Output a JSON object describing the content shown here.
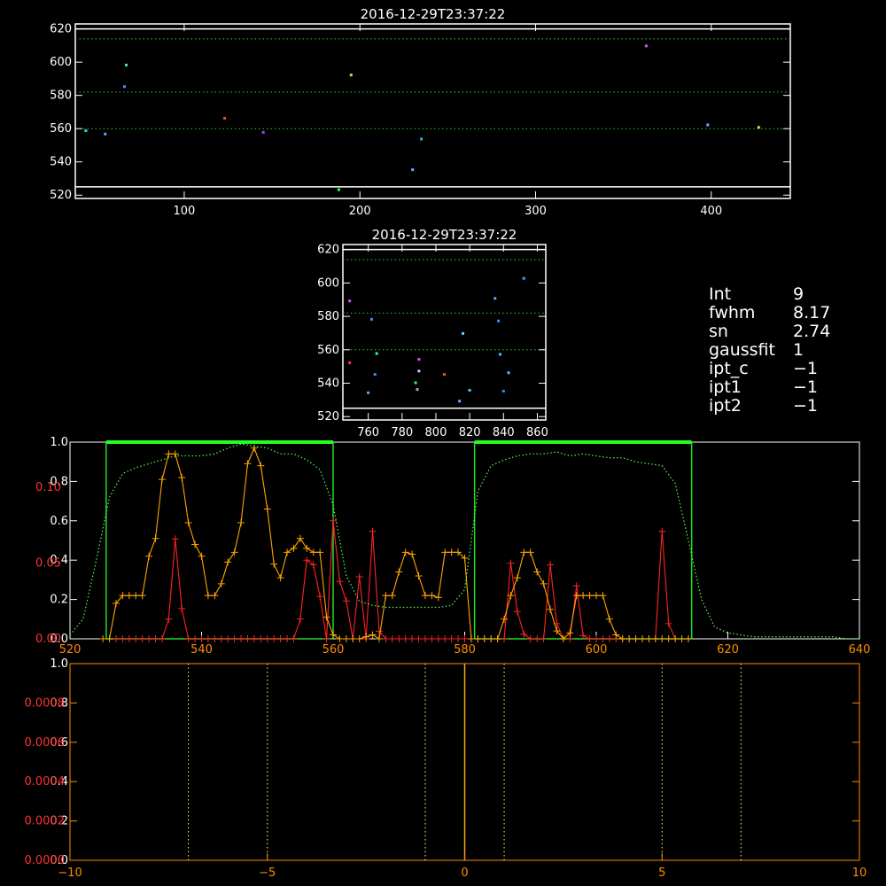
{
  "chart_data": [
    {
      "id": "scatter-top",
      "type": "scatter",
      "title": "2016-12-29T23:37:22",
      "xlim": [
        38,
        445
      ],
      "ylim": [
        518,
        623
      ],
      "xticks": [
        100,
        200,
        300,
        400
      ],
      "yticks": [
        520,
        540,
        560,
        580,
        600,
        620
      ],
      "hlines_dotted": [
        614,
        582,
        560
      ],
      "hlines_solid": [
        620,
        525
      ],
      "points": [
        {
          "x": 44,
          "y": 558.5,
          "color": "#33ccff"
        },
        {
          "x": 55,
          "y": 556.5,
          "color": "#55aaff"
        },
        {
          "x": 66,
          "y": 585,
          "color": "#4f8bff"
        },
        {
          "x": 67,
          "y": 598,
          "color": "#33eecc"
        },
        {
          "x": 123,
          "y": 566,
          "color": "#ff4422"
        },
        {
          "x": 145,
          "y": 557.5,
          "color": "#aa44ff"
        },
        {
          "x": 188,
          "y": 523,
          "color": "#33ff66"
        },
        {
          "x": 195,
          "y": 592,
          "color": "#dddd33"
        },
        {
          "x": 230,
          "y": 535,
          "color": "#77aaff"
        },
        {
          "x": 235,
          "y": 553.5,
          "color": "#33aaff"
        },
        {
          "x": 363,
          "y": 609.5,
          "color": "#cc55ff"
        },
        {
          "x": 398,
          "y": 562,
          "color": "#77aaff"
        },
        {
          "x": 427,
          "y": 560.5,
          "color": "#dddd33"
        }
      ]
    },
    {
      "id": "scatter-mid",
      "type": "scatter",
      "title": "2016-12-29T23:37:22",
      "xlim": [
        745,
        865
      ],
      "ylim": [
        518,
        623
      ],
      "xticks": [
        760,
        780,
        800,
        820,
        840,
        860
      ],
      "yticks": [
        520,
        540,
        560,
        580,
        600,
        620
      ],
      "hlines_dotted": [
        614,
        582,
        560
      ],
      "hlines_solid": [
        620,
        525
      ],
      "points": [
        {
          "x": 749,
          "y": 552,
          "color": "#ff3355"
        },
        {
          "x": 749,
          "y": 589,
          "color": "#cc55ff"
        },
        {
          "x": 760,
          "y": 534,
          "color": "#55aaff"
        },
        {
          "x": 762,
          "y": 578,
          "color": "#4488ff"
        },
        {
          "x": 764,
          "y": 545,
          "color": "#4488ff"
        },
        {
          "x": 765,
          "y": 557.5,
          "color": "#33ffaa"
        },
        {
          "x": 788,
          "y": 540,
          "color": "#33ff66"
        },
        {
          "x": 789,
          "y": 536,
          "color": "#aaaaaa"
        },
        {
          "x": 790,
          "y": 547,
          "color": "#ccccff"
        },
        {
          "x": 790,
          "y": 554,
          "color": "#cc55ff"
        },
        {
          "x": 805,
          "y": 545,
          "color": "#ff4422"
        },
        {
          "x": 814,
          "y": 529,
          "color": "#77aaff"
        },
        {
          "x": 816,
          "y": 569.5,
          "color": "#55ddff"
        },
        {
          "x": 820,
          "y": 535.5,
          "color": "#33ccff"
        },
        {
          "x": 835,
          "y": 590.5,
          "color": "#55aaff"
        },
        {
          "x": 837,
          "y": 577,
          "color": "#4488ff"
        },
        {
          "x": 838,
          "y": 557,
          "color": "#33ccff"
        },
        {
          "x": 840,
          "y": 535,
          "color": "#4488ff"
        },
        {
          "x": 843,
          "y": 546,
          "color": "#33ccff"
        },
        {
          "x": 852,
          "y": 602.5,
          "color": "#33aaff"
        }
      ]
    },
    {
      "id": "spectrum",
      "type": "line",
      "xlim": [
        520,
        640
      ],
      "xticks": [
        520,
        540,
        560,
        580,
        600,
        620,
        640
      ],
      "left_ticks_white": [
        "0.0",
        "0.2",
        "0.4",
        "0.6",
        "0.8",
        "1.0"
      ],
      "left_ticks_red": [
        "0.00",
        "0.05",
        "0.10"
      ],
      "right_ticks_white": [
        "0.0",
        "0.2",
        "0.4",
        "0.6",
        "0.8",
        "1.0"
      ],
      "filter_windows": [
        [
          525.5,
          560
        ],
        [
          581.5,
          614.5
        ]
      ],
      "series": [
        {
          "color": "#ff2222",
          "x": [
            527,
            528,
            529,
            530,
            531,
            532,
            533,
            534,
            535,
            536,
            537,
            538,
            539,
            540,
            541,
            542,
            543,
            544,
            545,
            546,
            547,
            548,
            549,
            550,
            551,
            552,
            553,
            554,
            555,
            556,
            557,
            558,
            559,
            560,
            561,
            562,
            563,
            564,
            565,
            566,
            567,
            568,
            569,
            570,
            571,
            572,
            573,
            574,
            575,
            576,
            577,
            578,
            579,
            580,
            581,
            582,
            583,
            584,
            585,
            586,
            587,
            588,
            589,
            590,
            591,
            592,
            593,
            594,
            595,
            596,
            597,
            598,
            599,
            600,
            601,
            602,
            603,
            604,
            605,
            606,
            607,
            608,
            609,
            610,
            611,
            612,
            613,
            614
          ],
          "y": [
            0,
            0,
            0,
            0,
            0,
            0,
            0,
            0,
            0.013,
            0.066,
            0.02,
            0,
            0,
            0,
            0,
            0,
            0,
            0,
            0,
            0,
            0,
            0,
            0,
            0,
            0,
            0,
            0,
            0,
            0.013,
            0.052,
            0.049,
            0.028,
            0,
            0.078,
            0.038,
            0.025,
            0,
            0.041,
            0,
            0.071,
            0.005,
            0,
            0,
            0,
            0,
            0,
            0,
            0,
            0,
            0,
            0,
            0,
            0,
            0,
            0,
            0,
            0,
            0,
            0,
            0,
            0.05,
            0.018,
            0.003,
            0,
            0,
            0,
            0.049,
            0.01,
            0,
            0,
            0.035,
            0.002,
            0,
            0,
            0,
            0,
            0,
            0,
            0,
            0,
            0,
            0,
            0,
            0.071,
            0.01,
            0,
            0,
            0
          ]
        },
        {
          "color": "#ffa500",
          "x": [
            525,
            526,
            527,
            528,
            529,
            530,
            531,
            532,
            533,
            534,
            535,
            536,
            537,
            538,
            539,
            540,
            541,
            542,
            543,
            544,
            545,
            546,
            547,
            548,
            549,
            550,
            551,
            552,
            553,
            554,
            555,
            556,
            557,
            558,
            559,
            560,
            561,
            562,
            563,
            564,
            565,
            566,
            567,
            568,
            569,
            570,
            571,
            572,
            573,
            574,
            575,
            576,
            577,
            578,
            579,
            580,
            581,
            582,
            583,
            584,
            585,
            586,
            587,
            588,
            589,
            590,
            591,
            592,
            593,
            594,
            595,
            596,
            597,
            598,
            599,
            600,
            601,
            602,
            603,
            604,
            605,
            606,
            607,
            608,
            609,
            610,
            611,
            612,
            613,
            614
          ],
          "y": [
            0,
            0.0,
            0.18,
            0.22,
            0.22,
            0.22,
            0.22,
            0.42,
            0.51,
            0.81,
            0.94,
            0.94,
            0.82,
            0.59,
            0.48,
            0.42,
            0.22,
            0.22,
            0.28,
            0.39,
            0.44,
            0.59,
            0.89,
            0.97,
            0.88,
            0.66,
            0.38,
            0.31,
            0.44,
            0.46,
            0.51,
            0.46,
            0.44,
            0.44,
            0.11,
            0.02,
            0,
            0.0,
            0,
            0.0,
            0.01,
            0.02,
            0.0,
            0.22,
            0.22,
            0.34,
            0.44,
            0.43,
            0.32,
            0.22,
            0.22,
            0.21,
            0.44,
            0.44,
            0.44,
            0.41,
            0,
            0,
            0,
            0,
            0,
            0.1,
            0.22,
            0.31,
            0.44,
            0.44,
            0.34,
            0.28,
            0.15,
            0.04,
            0,
            0.03,
            0.22,
            0.22,
            0.22,
            0.22,
            0.22,
            0.1,
            0.02,
            0,
            0,
            0,
            0,
            0,
            0,
            0,
            0,
            0,
            0,
            0
          ]
        },
        {
          "color": "#55ff55",
          "style": "dotted",
          "x": [
            520,
            522,
            524,
            526,
            528,
            530,
            532,
            534,
            536,
            538,
            540,
            542,
            544,
            546,
            548,
            550,
            552,
            554,
            556,
            558,
            560,
            562,
            564,
            566,
            568,
            570,
            572,
            574,
            576,
            578,
            580,
            582,
            584,
            586,
            588,
            590,
            592,
            594,
            596,
            598,
            600,
            602,
            604,
            606,
            608,
            610,
            612,
            614,
            616,
            618,
            620,
            622,
            624,
            626,
            628,
            630,
            632,
            634,
            636,
            638,
            640
          ],
          "y": [
            0.02,
            0.1,
            0.4,
            0.72,
            0.84,
            0.87,
            0.89,
            0.91,
            0.93,
            0.93,
            0.93,
            0.94,
            0.97,
            0.99,
            0.98,
            0.97,
            0.94,
            0.94,
            0.91,
            0.86,
            0.68,
            0.32,
            0.19,
            0.17,
            0.16,
            0.16,
            0.16,
            0.16,
            0.16,
            0.17,
            0.25,
            0.75,
            0.88,
            0.91,
            0.93,
            0.94,
            0.94,
            0.95,
            0.93,
            0.94,
            0.93,
            0.92,
            0.92,
            0.9,
            0.89,
            0.88,
            0.79,
            0.5,
            0.2,
            0.06,
            0.03,
            0.02,
            0.01,
            0.01,
            0.01,
            0.01,
            0.01,
            0.01,
            0.01,
            0.0,
            0.0
          ]
        }
      ]
    },
    {
      "id": "profile",
      "type": "line",
      "xlim": [
        -10,
        10
      ],
      "xticks": [
        -10,
        -5,
        0,
        5,
        10
      ],
      "left_ticks_white": [
        "0.0",
        "0.2",
        "0.4",
        "0.6",
        "0.8",
        "1.0"
      ],
      "left_ticks_red": [
        "0.0000",
        "0.0002",
        "0.0004",
        "0.0006",
        "0.0008"
      ],
      "vlines_dotted": [
        -7,
        -5,
        -1,
        1,
        5,
        7
      ],
      "vline_solid": 0
    }
  ],
  "info_panel": [
    {
      "key": "Int",
      "value": "9"
    },
    {
      "key": "fwhm",
      "value": "8.17"
    },
    {
      "key": "sn",
      "value": "2.74"
    },
    {
      "key": "gaussfit",
      "value": "1"
    },
    {
      "key": "ipt_c",
      "value": "−1"
    },
    {
      "key": "ipt1",
      "value": "−1"
    },
    {
      "key": "ipt2",
      "value": "−1"
    }
  ]
}
